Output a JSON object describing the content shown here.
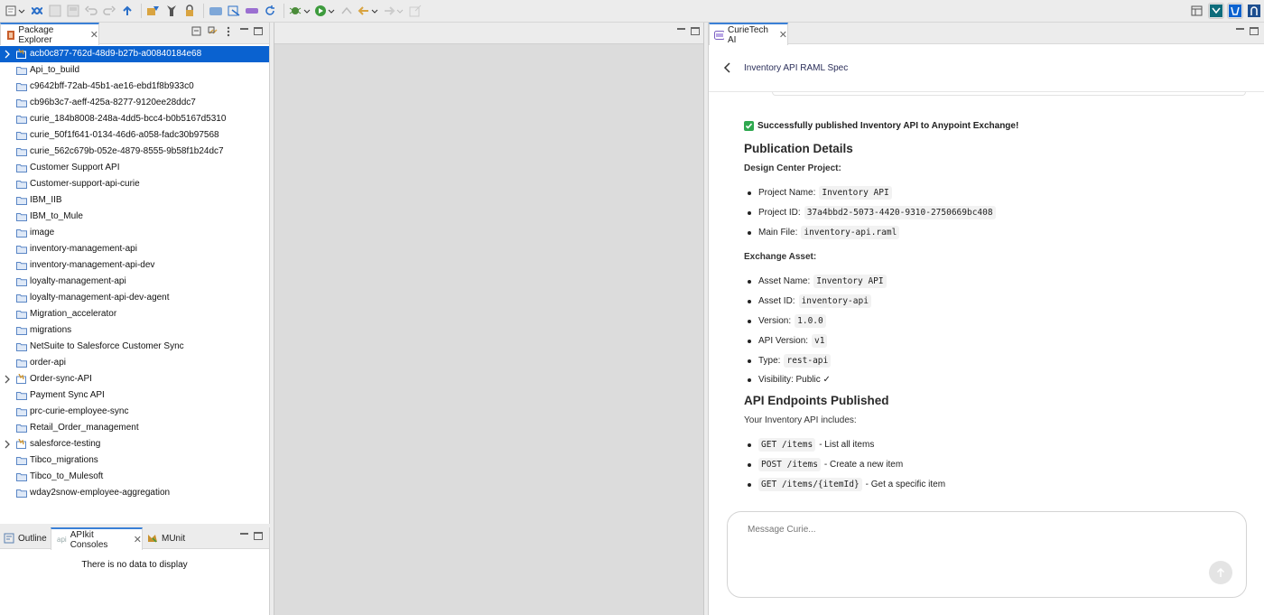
{
  "toolbar": {
    "left_icons": [
      "new-icon",
      "mule-icon",
      "save-icon",
      "save-all-icon",
      "undo-icon",
      "redo-icon",
      "publish-icon",
      "run-deploy-icon",
      "mule-cat-icon",
      "lock-icon",
      "cloud-icon",
      "api-sync-icon",
      "anypoint-icon",
      "refresh-icon",
      "debug-icon",
      "run-icon",
      "next-annotation-icon",
      "back-icon",
      "forward-icon",
      "external-icon"
    ],
    "right_icons": [
      "open-perspective-icon",
      "mule-design-perspective-icon",
      "mule-perspective-icon",
      "java-perspective-icon"
    ]
  },
  "package_explorer": {
    "tab_label": "Package Explorer",
    "items": [
      {
        "label": "acb0c877-762d-48d9-b27b-a00840184e68",
        "expandable": true,
        "selected": true,
        "type": "mule-project"
      },
      {
        "label": "Api_to_build",
        "expandable": false,
        "selected": false,
        "type": "folder"
      },
      {
        "label": "c9642bff-72ab-45b1-ae16-ebd1f8b933c0",
        "expandable": false,
        "selected": false,
        "type": "folder"
      },
      {
        "label": "cb96b3c7-aeff-425a-8277-9120ee28ddc7",
        "expandable": false,
        "selected": false,
        "type": "folder"
      },
      {
        "label": "curie_184b8008-248a-4dd5-bcc4-b0b5167d5310",
        "expandable": false,
        "selected": false,
        "type": "folder"
      },
      {
        "label": "curie_50f1f641-0134-46d6-a058-fadc30b97568",
        "expandable": false,
        "selected": false,
        "type": "folder"
      },
      {
        "label": "curie_562c679b-052e-4879-8555-9b58f1b24dc7",
        "expandable": false,
        "selected": false,
        "type": "folder"
      },
      {
        "label": "Customer Support API",
        "expandable": false,
        "selected": false,
        "type": "folder"
      },
      {
        "label": "Customer-support-api-curie",
        "expandable": false,
        "selected": false,
        "type": "folder"
      },
      {
        "label": "IBM_IIB",
        "expandable": false,
        "selected": false,
        "type": "folder"
      },
      {
        "label": "IBM_to_Mule",
        "expandable": false,
        "selected": false,
        "type": "folder"
      },
      {
        "label": "image",
        "expandable": false,
        "selected": false,
        "type": "folder"
      },
      {
        "label": "inventory-management-api",
        "expandable": false,
        "selected": false,
        "type": "folder"
      },
      {
        "label": "inventory-management-api-dev",
        "expandable": false,
        "selected": false,
        "type": "folder"
      },
      {
        "label": "loyalty-management-api",
        "expandable": false,
        "selected": false,
        "type": "folder"
      },
      {
        "label": "loyalty-management-api-dev-agent",
        "expandable": false,
        "selected": false,
        "type": "folder"
      },
      {
        "label": "Migration_accelerator",
        "expandable": false,
        "selected": false,
        "type": "folder"
      },
      {
        "label": "migrations",
        "expandable": false,
        "selected": false,
        "type": "folder"
      },
      {
        "label": "NetSuite to Salesforce Customer Sync",
        "expandable": false,
        "selected": false,
        "type": "folder"
      },
      {
        "label": "order-api",
        "expandable": false,
        "selected": false,
        "type": "folder"
      },
      {
        "label": "Order-sync-API",
        "expandable": true,
        "selected": false,
        "type": "mule-project"
      },
      {
        "label": "Payment Sync API",
        "expandable": false,
        "selected": false,
        "type": "folder"
      },
      {
        "label": "prc-curie-employee-sync",
        "expandable": false,
        "selected": false,
        "type": "folder"
      },
      {
        "label": "Retail_Order_management",
        "expandable": false,
        "selected": false,
        "type": "folder"
      },
      {
        "label": "salesforce-testing",
        "expandable": true,
        "selected": false,
        "type": "mule-project"
      },
      {
        "label": "Tibco_migrations",
        "expandable": false,
        "selected": false,
        "type": "folder"
      },
      {
        "label": "Tibco_to_Mulesoft",
        "expandable": false,
        "selected": false,
        "type": "folder"
      },
      {
        "label": "wday2snow-employee-aggregation",
        "expandable": false,
        "selected": false,
        "type": "folder"
      }
    ]
  },
  "bottom_panel": {
    "tabs": [
      {
        "label": "Outline",
        "active": false
      },
      {
        "label": "APIkit Consoles",
        "active": true
      },
      {
        "label": "MUnit",
        "active": false
      }
    ],
    "empty_message": "There is no data to display"
  },
  "curie": {
    "tab_label": "CurieTech AI",
    "header_title": "Inventory API RAML Spec",
    "success_text": "Successfully published Inventory API to Anypoint Exchange!",
    "publication_heading": "Publication Details",
    "design_center_label": "Design Center Project:",
    "design_center_items": [
      {
        "label": "Project Name:",
        "value": "Inventory API"
      },
      {
        "label": "Project ID:",
        "value": "37a4bbd2-5073-4420-9310-2750669bc408"
      },
      {
        "label": "Main File:",
        "value": "inventory-api.raml"
      }
    ],
    "exchange_label": "Exchange Asset:",
    "exchange_items": [
      {
        "label": "Asset Name:",
        "value": "Inventory API"
      },
      {
        "label": "Asset ID:",
        "value": "inventory-api"
      },
      {
        "label": "Version:",
        "value": "1.0.0"
      },
      {
        "label": "API Version:",
        "value": "v1"
      },
      {
        "label": "Type:",
        "value": "rest-api"
      }
    ],
    "visibility_text": "Visibility: Public ✓",
    "endpoints_heading": "API Endpoints Published",
    "endpoints_intro": "Your Inventory API includes:",
    "endpoints": [
      {
        "code": "GET /items",
        "desc": "- List all items"
      },
      {
        "code": "POST /items",
        "desc": "- Create a new item"
      },
      {
        "code": "GET /items/{itemId}",
        "desc": "- Get a specific item"
      }
    ],
    "composer_placeholder": "Message Curie..."
  },
  "colors": {
    "selection": "#0a62d0",
    "accent_tab": "#3a80d6",
    "success_check": "#2fa84f",
    "title_text": "#2b2f5a"
  }
}
